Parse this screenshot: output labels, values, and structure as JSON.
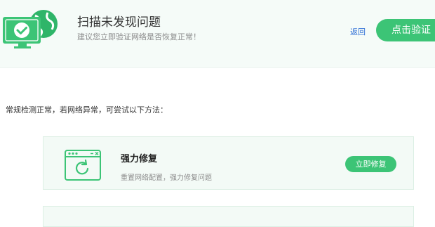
{
  "header": {
    "icon": "monitor-check-globe-icon",
    "title": "扫描未发现问题",
    "subtitle": "建议您立即验证网络是否恢复正常！",
    "back_label": "返回",
    "verify_label": "点击验证",
    "accent_color": "#3cc476",
    "link_color": "#2f6fd6"
  },
  "hint_text": "常规检测正常，若网络异常，可尝试以下方法：",
  "fix_options": [
    {
      "icon": "window-refresh-icon",
      "title": "强力修复",
      "description": "重置网络配置，强力修复问题",
      "button_label": "立即修复"
    }
  ]
}
